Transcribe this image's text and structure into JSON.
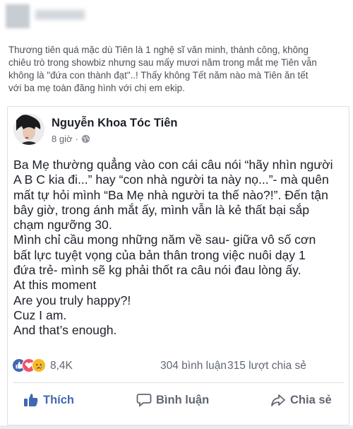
{
  "outer_post": {
    "text_lines": [
      "Thương tiên quá mặc dù Tiên là 1 nghệ sĩ văn minh, thành công, không",
      "chiêu trò trong showbiz nhưng sau mấy mươi năm trong mắt mẹ Tiên vẫn",
      "không là \"đứa con thành đạt\"..! Thấy không Tết năm nào mà Tiên ăn tết",
      "với ba mẹ toàn đăng hình với chị em ekip."
    ]
  },
  "shared_post": {
    "author": "Nguyễn Khoa Tóc Tiên",
    "time": "8 giờ",
    "text_lines": [
      "Ba Mẹ thường quẳng vào con cái câu nói “hãy nhìn người",
      "A B C kia đi...” hay “con nhà người ta này nọ...”- mà quên",
      "mất tự hỏi mình “Ba Mẹ nhà người ta thế nào?!”. Đến tận",
      "bây giờ, trong ánh mắt ấy, mình vẫn là kẻ thất bại sắp",
      "chạm ngưỡng 30.",
      "Mình chỉ cầu mong những năm về sau- giữa vô số cơn",
      "bất lực tuyệt vọng của bản thân trong việc nuôi dạy 1",
      "đứa trẻ- mình sẽ kg phải thốt ra câu nói đau lòng ấy.",
      "At this moment",
      "Are you truly happy?!",
      "Cuz I am.",
      "And that’s enough."
    ],
    "reactions": {
      "count": "8,4K",
      "comments": "304 bình luận",
      "shares": "315 lượt chia sẻ",
      "icons": [
        "like-icon",
        "love-icon",
        "sad-icon"
      ]
    },
    "actions": {
      "like": "Thích",
      "comment": "Bình luận",
      "share": "Chia sẻ"
    }
  },
  "colors": {
    "facebook_blue": "#4267b2",
    "text": "#1d2129",
    "muted": "#606770",
    "love_red": "#f25268",
    "sad_yellow": "#f7b928"
  }
}
